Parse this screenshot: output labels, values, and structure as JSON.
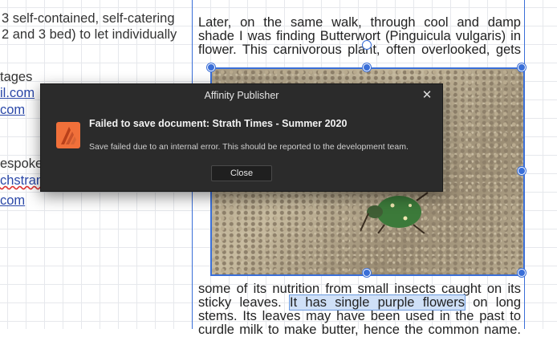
{
  "left_column": {
    "line1": "3 self-contained, self-catering",
    "line2": "2 and 3 bed) to let individually",
    "line3": "tages",
    "line4": "il.com",
    "line5": "com",
    "line6": "espoke",
    "line7": "chstran",
    "line8": "com"
  },
  "right_column": {
    "top_lines": [
      "Later, on the same walk, through cool and damp",
      "shade I was finding Butterwort (Pinguicula vulgaris) in",
      "flower. This carnivorous plant, often overlooked, gets"
    ],
    "bottom_line1": "some of its nutrition from small insects caught on its",
    "bottom_line2_pre": "sticky leaves. ",
    "bottom_line2_sel": "It has single purple flowers",
    "bottom_line2_post": " on long",
    "bottom_line3": "stems. Its leaves may have been used in the past to",
    "bottom_line4": "curdle milk to make butter, hence the common name."
  },
  "dialog": {
    "title": "Affinity Publisher",
    "heading": "Failed to save document: Strath Times - Summer 2020",
    "message": "Save failed due to an internal error. This should be reported to the development team.",
    "button": "Close",
    "close_icon": "close-icon",
    "app_icon": "affinity-publisher-icon",
    "accent": "#f0703a"
  },
  "colors": {
    "guide": "#3a6fd8",
    "dialog_bg": "#2b2b2b"
  }
}
